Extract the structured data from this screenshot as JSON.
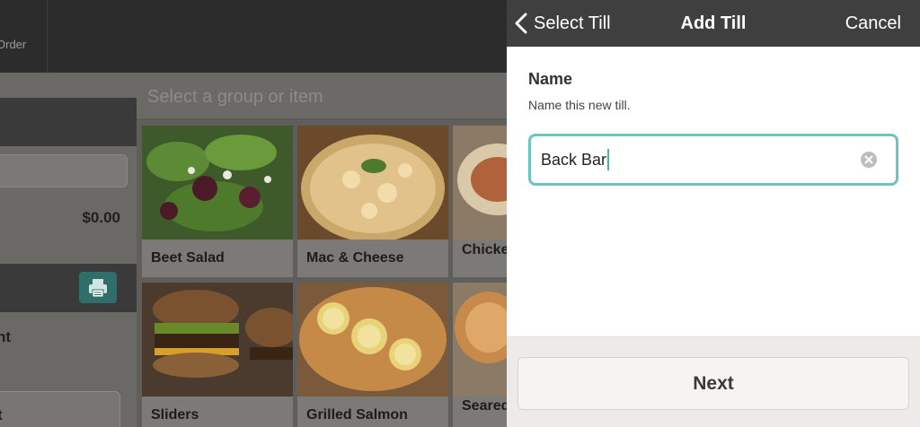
{
  "background": {
    "order_label": "Order",
    "order_total": "$0.00",
    "left_text": "nt",
    "left_button_label": "t",
    "search_placeholder": "Select a group or item",
    "items": [
      {
        "label": "Beet Salad"
      },
      {
        "label": "Mac & Cheese"
      },
      {
        "label": "Chicken Parme"
      },
      {
        "label": "Sliders"
      },
      {
        "label": "Grilled Salmon"
      },
      {
        "label": "Seared"
      }
    ],
    "icons": {
      "print": "printer-icon"
    }
  },
  "panel": {
    "nav": {
      "back_label": "Select Till",
      "title": "Add Till",
      "cancel_label": "Cancel"
    },
    "field": {
      "title": "Name",
      "help": "Name this new till.",
      "value": "Back Bar"
    },
    "next_label": "Next"
  },
  "colors": {
    "accent": "#6cc3c1",
    "nav_bg": "#3f3f3f",
    "print_button": "#2f6e6a"
  }
}
